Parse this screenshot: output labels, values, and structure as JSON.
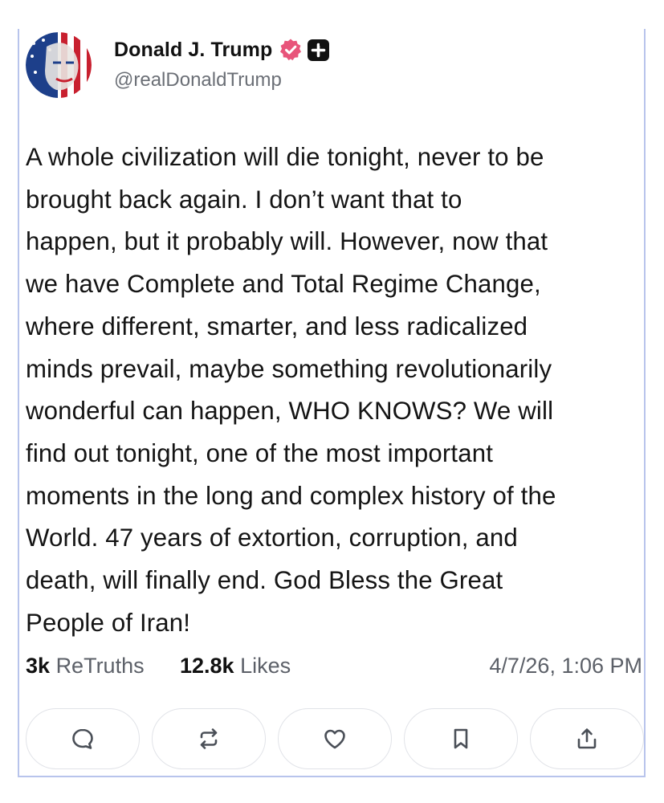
{
  "author": {
    "display_name": "Donald J. Trump",
    "handle": "@realDonaldTrump",
    "verified_icon": "verified-badge-icon",
    "plus_icon": "plus-badge-icon"
  },
  "post": {
    "lines": [
      "A whole civilization will die tonight, never to be",
      "brought back again. I don’t want that to",
      "happen, but it probably will. However, now that",
      "we have Complete and Total Regime Change,",
      "where different, smarter, and less radicalized",
      "minds prevail, maybe something revolutionarily",
      "wonderful can happen, WHO KNOWS? We will",
      "find out tonight, one of the most important",
      "moments in the long and complex history of the",
      "World. 47 years of extortion, corruption, and",
      "death, will finally end. God Bless the Great",
      "People of Iran!"
    ]
  },
  "stats": {
    "retruths_count": "3k",
    "retruths_label": "ReTruths",
    "likes_count": "12.8k",
    "likes_label": "Likes",
    "timestamp": "4/7/26, 1:06 PM"
  },
  "actions": [
    {
      "icon": "reply-icon"
    },
    {
      "icon": "retruth-icon"
    },
    {
      "icon": "like-icon"
    },
    {
      "icon": "bookmark-icon"
    },
    {
      "icon": "share-icon"
    }
  ],
  "colors": {
    "card_border": "#b8c4ec",
    "verified_badge": "#e8547a",
    "text_primary": "#141414",
    "text_secondary": "#5c6068"
  }
}
